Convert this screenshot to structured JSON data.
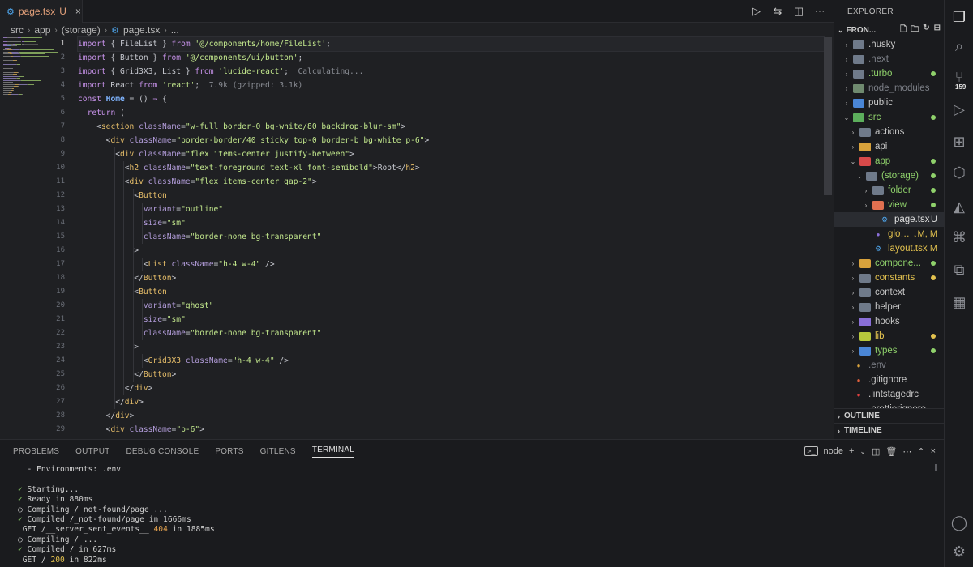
{
  "tab": {
    "icon": "gear-icon",
    "name": "page.tsx",
    "status": "U",
    "close": "×"
  },
  "editor_actions": [
    "play-icon",
    "diff-icon",
    "split-icon",
    "more-icon"
  ],
  "breadcrumb": [
    "src",
    "app",
    "(storage)",
    "page.tsx",
    "..."
  ],
  "code": {
    "active_line": 1,
    "lines": [
      [
        [
          "kw",
          "import"
        ],
        [
          "tx",
          " { "
        ],
        [
          "tx",
          "FileList"
        ],
        [
          "tx",
          " } "
        ],
        [
          "kw",
          "from"
        ],
        [
          "st",
          " '@/components/home/FileList'"
        ],
        [
          "tx",
          ";"
        ]
      ],
      [
        [
          "kw",
          "import"
        ],
        [
          "tx",
          " { "
        ],
        [
          "tx",
          "Button"
        ],
        [
          "tx",
          " } "
        ],
        [
          "kw",
          "from"
        ],
        [
          "st",
          " '@/components/ui/button'"
        ],
        [
          "tx",
          ";"
        ]
      ],
      [
        [
          "kw",
          "import"
        ],
        [
          "tx",
          " { "
        ],
        [
          "tx",
          "Grid3X3"
        ],
        [
          "tx",
          ", "
        ],
        [
          "tx",
          "List"
        ],
        [
          "tx",
          " } "
        ],
        [
          "kw",
          "from"
        ],
        [
          "st",
          " 'lucide-react'"
        ],
        [
          "tx",
          ";  "
        ],
        [
          "hint",
          "Calculating..."
        ]
      ],
      [
        [
          "kw",
          "import"
        ],
        [
          "tx",
          " React "
        ],
        [
          "kw",
          "from"
        ],
        [
          "st",
          " 'react'"
        ],
        [
          "tx",
          ";  "
        ],
        [
          "hint",
          "7.9k (gzipped: 3.1k)"
        ]
      ],
      [
        [
          "kw",
          "const"
        ],
        [
          "fn",
          " Home"
        ],
        [
          "tx",
          " = () "
        ],
        [
          "kw",
          "⇒"
        ],
        [
          "tx",
          " {"
        ]
      ],
      [
        [
          "tx",
          "  "
        ],
        [
          "kw",
          "return"
        ],
        [
          "tx",
          " ("
        ]
      ],
      [
        [
          "tx",
          "    <"
        ],
        [
          "tg",
          "section"
        ],
        [
          "at",
          " className"
        ],
        [
          "tx",
          "="
        ],
        [
          "st",
          "\"w-full border-0 bg-white/80 backdrop-blur-sm\""
        ],
        [
          "tx",
          ">"
        ]
      ],
      [
        [
          "tx",
          "      <"
        ],
        [
          "tg",
          "div"
        ],
        [
          "at",
          " className"
        ],
        [
          "tx",
          "="
        ],
        [
          "st",
          "\"border-border/40 sticky top-0 border-b bg-white p-6\""
        ],
        [
          "tx",
          ">"
        ]
      ],
      [
        [
          "tx",
          "        <"
        ],
        [
          "tg",
          "div"
        ],
        [
          "at",
          " className"
        ],
        [
          "tx",
          "="
        ],
        [
          "st",
          "\"flex items-center justify-between\""
        ],
        [
          "tx",
          ">"
        ]
      ],
      [
        [
          "tx",
          "          <"
        ],
        [
          "tg",
          "h2"
        ],
        [
          "at",
          " className"
        ],
        [
          "tx",
          "="
        ],
        [
          "st",
          "\"text-foreground text-xl font-semibold\""
        ],
        [
          "tx",
          ">Root</"
        ],
        [
          "tg",
          "h2"
        ],
        [
          "tx",
          ">"
        ]
      ],
      [
        [
          "tx",
          "          <"
        ],
        [
          "tg",
          "div"
        ],
        [
          "at",
          " className"
        ],
        [
          "tx",
          "="
        ],
        [
          "st",
          "\"flex items-center gap-2\""
        ],
        [
          "tx",
          ">"
        ]
      ],
      [
        [
          "tx",
          "            <"
        ],
        [
          "tg",
          "Button"
        ]
      ],
      [
        [
          "at",
          "              variant"
        ],
        [
          "tx",
          "="
        ],
        [
          "st",
          "\"outline\""
        ]
      ],
      [
        [
          "at",
          "              size"
        ],
        [
          "tx",
          "="
        ],
        [
          "st",
          "\"sm\""
        ]
      ],
      [
        [
          "at",
          "              className"
        ],
        [
          "tx",
          "="
        ],
        [
          "st",
          "\"border-none bg-transparent\""
        ]
      ],
      [
        [
          "tx",
          "            >"
        ]
      ],
      [
        [
          "tx",
          "              <"
        ],
        [
          "tg",
          "List"
        ],
        [
          "at",
          " className"
        ],
        [
          "tx",
          "="
        ],
        [
          "st",
          "\"h-4 w-4\""
        ],
        [
          "tx",
          " />"
        ]
      ],
      [
        [
          "tx",
          "            </"
        ],
        [
          "tg",
          "Button"
        ],
        [
          "tx",
          ">"
        ]
      ],
      [
        [
          "tx",
          "            <"
        ],
        [
          "tg",
          "Button"
        ]
      ],
      [
        [
          "at",
          "              variant"
        ],
        [
          "tx",
          "="
        ],
        [
          "st",
          "\"ghost\""
        ]
      ],
      [
        [
          "at",
          "              size"
        ],
        [
          "tx",
          "="
        ],
        [
          "st",
          "\"sm\""
        ]
      ],
      [
        [
          "at",
          "              className"
        ],
        [
          "tx",
          "="
        ],
        [
          "st",
          "\"border-none bg-transparent\""
        ]
      ],
      [
        [
          "tx",
          "            >"
        ]
      ],
      [
        [
          "tx",
          "              <"
        ],
        [
          "tg",
          "Grid3X3"
        ],
        [
          "at",
          " className"
        ],
        [
          "tx",
          "="
        ],
        [
          "st",
          "\"h-4 w-4\""
        ],
        [
          "tx",
          " />"
        ]
      ],
      [
        [
          "tx",
          "            </"
        ],
        [
          "tg",
          "Button"
        ],
        [
          "tx",
          ">"
        ]
      ],
      [
        [
          "tx",
          "          </"
        ],
        [
          "tg",
          "div"
        ],
        [
          "tx",
          ">"
        ]
      ],
      [
        [
          "tx",
          "        </"
        ],
        [
          "tg",
          "div"
        ],
        [
          "tx",
          ">"
        ]
      ],
      [
        [
          "tx",
          "      </"
        ],
        [
          "tg",
          "div"
        ],
        [
          "tx",
          ">"
        ]
      ],
      [
        [
          "tx",
          "      <"
        ],
        [
          "tg",
          "div"
        ],
        [
          "at",
          " className"
        ],
        [
          "tx",
          "="
        ],
        [
          "st",
          "\"p-6\""
        ],
        [
          "tx",
          ">"
        ]
      ]
    ]
  },
  "explorer": {
    "title": "EXPLORER",
    "root": "FRON...",
    "outline": "OUTLINE",
    "timeline": "TIMELINE",
    "items": [
      {
        "depth": 0,
        "chev": "›",
        "icon": "folder-husky-icon",
        "color": "#6f7a8a",
        "label": ".husky",
        "lcolor": "#c8c8c8",
        "badge": "",
        "dot": ""
      },
      {
        "depth": 0,
        "chev": "›",
        "icon": "folder-next-icon",
        "color": "#6f7a8a",
        "label": ".next",
        "lcolor": "#7d8088",
        "badge": "",
        "dot": ""
      },
      {
        "depth": 0,
        "chev": "›",
        "icon": "folder-turbo-icon",
        "color": "#6f7a8a",
        "label": ".turbo",
        "lcolor": "#8fd16b",
        "badge": "",
        "dot": "#8fd16b"
      },
      {
        "depth": 0,
        "chev": "›",
        "icon": "folder-node-icon",
        "color": "#6f8a6f",
        "label": "node_modules",
        "lcolor": "#7d8088",
        "badge": "",
        "dot": ""
      },
      {
        "depth": 0,
        "chev": "›",
        "icon": "folder-public-icon",
        "color": "#4a86d6",
        "label": "public",
        "lcolor": "#c8c8c8",
        "badge": "",
        "dot": ""
      },
      {
        "depth": 0,
        "chev": "⌄",
        "icon": "folder-src-icon",
        "color": "#5cae5c",
        "label": "src",
        "lcolor": "#8fd16b",
        "badge": "",
        "dot": "#8fd16b"
      },
      {
        "depth": 1,
        "chev": "›",
        "icon": "folder-actions-icon",
        "color": "#6f7a8a",
        "label": "actions",
        "lcolor": "#c8c8c8",
        "badge": "",
        "dot": ""
      },
      {
        "depth": 1,
        "chev": "›",
        "icon": "folder-api-icon",
        "color": "#d8a23c",
        "label": "api",
        "lcolor": "#c8c8c8",
        "badge": "",
        "dot": ""
      },
      {
        "depth": 1,
        "chev": "⌄",
        "icon": "folder-app-icon",
        "color": "#d84a4a",
        "label": "app",
        "lcolor": "#8fd16b",
        "badge": "",
        "dot": "#8fd16b"
      },
      {
        "depth": 2,
        "chev": "⌄",
        "icon": "folder-open-icon",
        "color": "#6f7a8a",
        "label": "(storage)",
        "lcolor": "#8fd16b",
        "badge": "",
        "dot": "#8fd16b"
      },
      {
        "depth": 3,
        "chev": "›",
        "icon": "folder-icon",
        "color": "#6f7a8a",
        "label": "folder",
        "lcolor": "#8fd16b",
        "badge": "",
        "dot": "#8fd16b"
      },
      {
        "depth": 3,
        "chev": "›",
        "icon": "folder-view-icon",
        "color": "#e07050",
        "label": "view",
        "lcolor": "#8fd16b",
        "badge": "",
        "dot": "#8fd16b"
      },
      {
        "depth": 4,
        "chev": "",
        "icon": "gear-icon",
        "color": "#4fa8f0",
        "label": "page.tsx",
        "lcolor": "#e0e0e0",
        "badge": "U",
        "dot": "",
        "selected": true
      },
      {
        "depth": 3,
        "chev": "",
        "icon": "css-icon",
        "color": "#8a6fd8",
        "label": "glob...",
        "lcolor": "#e3c24f",
        "badge": "↓M, M",
        "dot": ""
      },
      {
        "depth": 3,
        "chev": "",
        "icon": "gear-icon",
        "color": "#4fa8f0",
        "label": "layout.tsx",
        "lcolor": "#e3c24f",
        "badge": "M",
        "dot": ""
      },
      {
        "depth": 1,
        "chev": "›",
        "icon": "folder-components-icon",
        "color": "#d8a23c",
        "label": "compone...",
        "lcolor": "#8fd16b",
        "badge": "",
        "dot": "#8fd16b"
      },
      {
        "depth": 1,
        "chev": "›",
        "icon": "folder-constants-icon",
        "color": "#6f7a8a",
        "label": "constants",
        "lcolor": "#e3c24f",
        "badge": "",
        "dot": "#e3c24f"
      },
      {
        "depth": 1,
        "chev": "›",
        "icon": "folder-context-icon",
        "color": "#6f7a8a",
        "label": "context",
        "lcolor": "#c8c8c8",
        "badge": "",
        "dot": ""
      },
      {
        "depth": 1,
        "chev": "›",
        "icon": "folder-helper-icon",
        "color": "#6f7a8a",
        "label": "helper",
        "lcolor": "#c8c8c8",
        "badge": "",
        "dot": ""
      },
      {
        "depth": 1,
        "chev": "›",
        "icon": "folder-hooks-icon",
        "color": "#8a6fd8",
        "label": "hooks",
        "lcolor": "#c8c8c8",
        "badge": "",
        "dot": ""
      },
      {
        "depth": 1,
        "chev": "›",
        "icon": "folder-lib-icon",
        "color": "#b8c83c",
        "label": "lib",
        "lcolor": "#e3c24f",
        "badge": "",
        "dot": "#e3c24f"
      },
      {
        "depth": 1,
        "chev": "›",
        "icon": "folder-types-icon",
        "color": "#4a86d6",
        "label": "types",
        "lcolor": "#8fd16b",
        "badge": "",
        "dot": "#8fd16b"
      },
      {
        "depth": 0,
        "chev": "",
        "icon": "env-icon",
        "color": "#d8a23c",
        "label": ".env",
        "lcolor": "#7d8088",
        "badge": "",
        "dot": ""
      },
      {
        "depth": 0,
        "chev": "",
        "icon": "git-icon",
        "color": "#e0603c",
        "label": ".gitignore",
        "lcolor": "#c8c8c8",
        "badge": "",
        "dot": ""
      },
      {
        "depth": 0,
        "chev": "",
        "icon": "lint-icon",
        "color": "#e04040",
        "label": ".lintstagedrc",
        "lcolor": "#c8c8c8",
        "badge": "",
        "dot": ""
      },
      {
        "depth": 0,
        "chev": "",
        "icon": "prettier-icon",
        "color": "#6f7a8a",
        "label": ".prettierignore",
        "lcolor": "#c8c8c8",
        "badge": "",
        "dot": ""
      }
    ]
  },
  "activity": {
    "icons": [
      "explorer-icon",
      "search-icon",
      "source-control-icon",
      "run-debug-icon",
      "extensions-icon",
      "remote-icon",
      "docker-icon",
      "prisma-icon",
      "python-icon",
      "diagram-icon",
      "database-icon",
      "account-icon",
      "settings-icon"
    ],
    "scm_count": "159"
  },
  "panel": {
    "tabs": [
      "PROBLEMS",
      "OUTPUT",
      "DEBUG CONSOLE",
      "PORTS",
      "GITLENS",
      "TERMINAL"
    ],
    "active_tab": "TERMINAL",
    "shell": "node",
    "terminal": [
      [
        [
          "ci",
          "  - Environments: .env"
        ]
      ],
      [
        [
          "ci",
          ""
        ]
      ],
      [
        [
          "ok",
          "✓"
        ],
        [
          "ci",
          " Starting..."
        ]
      ],
      [
        [
          "ok",
          "✓"
        ],
        [
          "ci",
          " Ready in 880ms"
        ]
      ],
      [
        [
          "ci",
          "○ Compiling /_not-found/page ..."
        ]
      ],
      [
        [
          "ok",
          "✓"
        ],
        [
          "ci",
          " Compiled /_not-found/page in 1666ms"
        ]
      ],
      [
        [
          "ci",
          " GET /__server_sent_events__ "
        ],
        [
          "code404",
          "404"
        ],
        [
          "ci",
          " in 1885ms"
        ]
      ],
      [
        [
          "ci",
          "○ Compiling / ..."
        ]
      ],
      [
        [
          "ok",
          "✓"
        ],
        [
          "ci",
          " Compiled / in 627ms"
        ]
      ],
      [
        [
          "ci",
          " GET / "
        ],
        [
          "code200",
          "200"
        ],
        [
          "ci",
          " in 822ms"
        ]
      ]
    ]
  }
}
